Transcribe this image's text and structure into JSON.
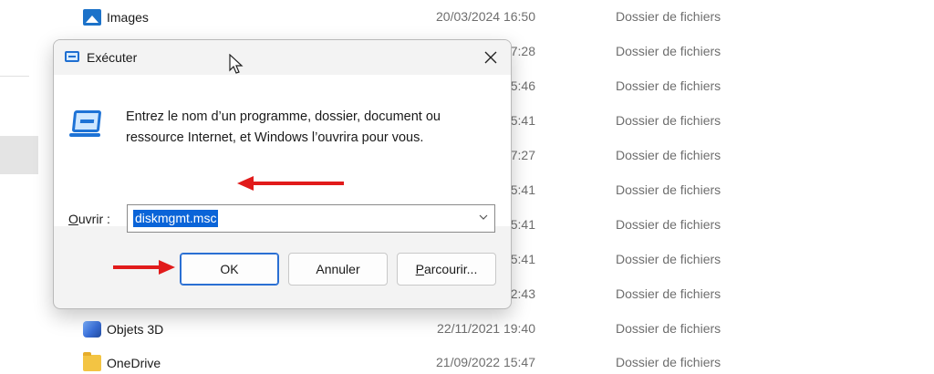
{
  "explorer": {
    "rows": [
      {
        "name": "Images",
        "icon": "images-icon",
        "date": "20/03/2024 16:50",
        "type": "Dossier de fichiers"
      },
      {
        "name": "",
        "icon": "",
        "date": "7:28",
        "type": "Dossier de fichiers"
      },
      {
        "name": "",
        "icon": "",
        "date": "5:46",
        "type": "Dossier de fichiers"
      },
      {
        "name": "",
        "icon": "",
        "date": "5:41",
        "type": "Dossier de fichiers"
      },
      {
        "name": "",
        "icon": "",
        "date": "7:27",
        "type": "Dossier de fichiers"
      },
      {
        "name": "",
        "icon": "",
        "date": "5:41",
        "type": "Dossier de fichiers"
      },
      {
        "name": "",
        "icon": "",
        "date": "5:41",
        "type": "Dossier de fichiers"
      },
      {
        "name": "",
        "icon": "",
        "date": "5:41",
        "type": "Dossier de fichiers"
      },
      {
        "name": "",
        "icon": "",
        "date": "2:43",
        "type": "Dossier de fichiers"
      },
      {
        "name": "Objets 3D",
        "icon": "3d-objects-icon",
        "date": "22/11/2021 19:40",
        "type": "Dossier de fichiers"
      },
      {
        "name": "OneDrive",
        "icon": "folder-icon",
        "date": "21/09/2022 15:47",
        "type": "Dossier de fichiers"
      }
    ]
  },
  "dialog": {
    "title": "Exécuter",
    "close_icon": "×",
    "instruction": "Entrez le nom d’un programme, dossier, document ou ressource Internet, et Windows l’ouvrira pour vous.",
    "open_label_accel": "O",
    "open_label_rest": "uvrir :",
    "open_value": "diskmgmt.msc",
    "chevron": "⌵",
    "ok_label": "OK",
    "cancel_label": "Annuler",
    "browse_accel": "P",
    "browse_rest": "arcourir..."
  },
  "colors": {
    "accent": "#0a64d8",
    "annotation_arrow": "#e11b1b"
  }
}
